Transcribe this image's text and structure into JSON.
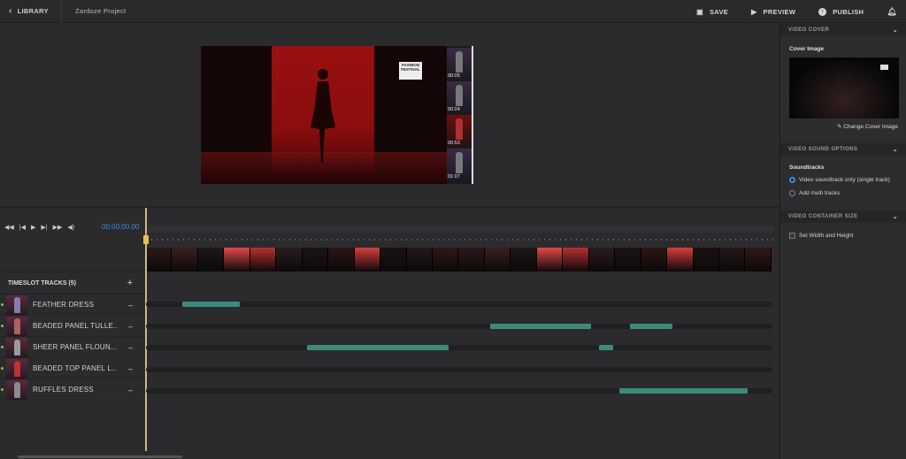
{
  "topbar": {
    "back_label": "LIBRARY",
    "project_name": "Zardoze Project",
    "save_label": "SAVE",
    "preview_label": "PREVIEW",
    "publish_label": "PUBLISH"
  },
  "preview": {
    "logo_text": "FASHION FESTIVAL",
    "thumbnails": [
      "00:05",
      "00:24",
      "00:53",
      "01:07"
    ]
  },
  "player": {
    "timecode": "00:00:00.00"
  },
  "tracks": {
    "header": "TIMESLOT TRACKS (5)",
    "items": [
      {
        "name": "FEATHER DRESS",
        "segments": [
          [
            0.058,
            0.15
          ]
        ]
      },
      {
        "name": "BEADED PANEL TULLE...",
        "segments": [
          [
            0.549,
            0.711
          ],
          [
            0.773,
            0.84
          ]
        ]
      },
      {
        "name": "SHEER PANEL FLOUN...",
        "segments": [
          [
            0.257,
            0.483
          ],
          [
            0.723,
            0.746
          ]
        ]
      },
      {
        "name": "BEADED TOP PANEL L...",
        "segments": []
      },
      {
        "name": "RUFFLES DRESS",
        "segments": [
          [
            0.756,
            0.961
          ]
        ]
      }
    ]
  },
  "right_panel": {
    "video_cover": {
      "header": "VIDEO COVER",
      "cover_label": "Cover Image",
      "change_label": "Change Cover Image"
    },
    "sound": {
      "header": "VIDEO SOUND OPTIONS",
      "label": "Soundtracks",
      "option_single": "Video soundtrack only (single track)",
      "option_multi": "Add multi tracks"
    },
    "container": {
      "header": "VIDEO CONTAINER SIZE",
      "checkbox_label": "Set Width and Height"
    }
  },
  "colors": {
    "accent": "#3d8fd8",
    "segment": "#3d8a7a",
    "playhead": "#e7c24a"
  }
}
